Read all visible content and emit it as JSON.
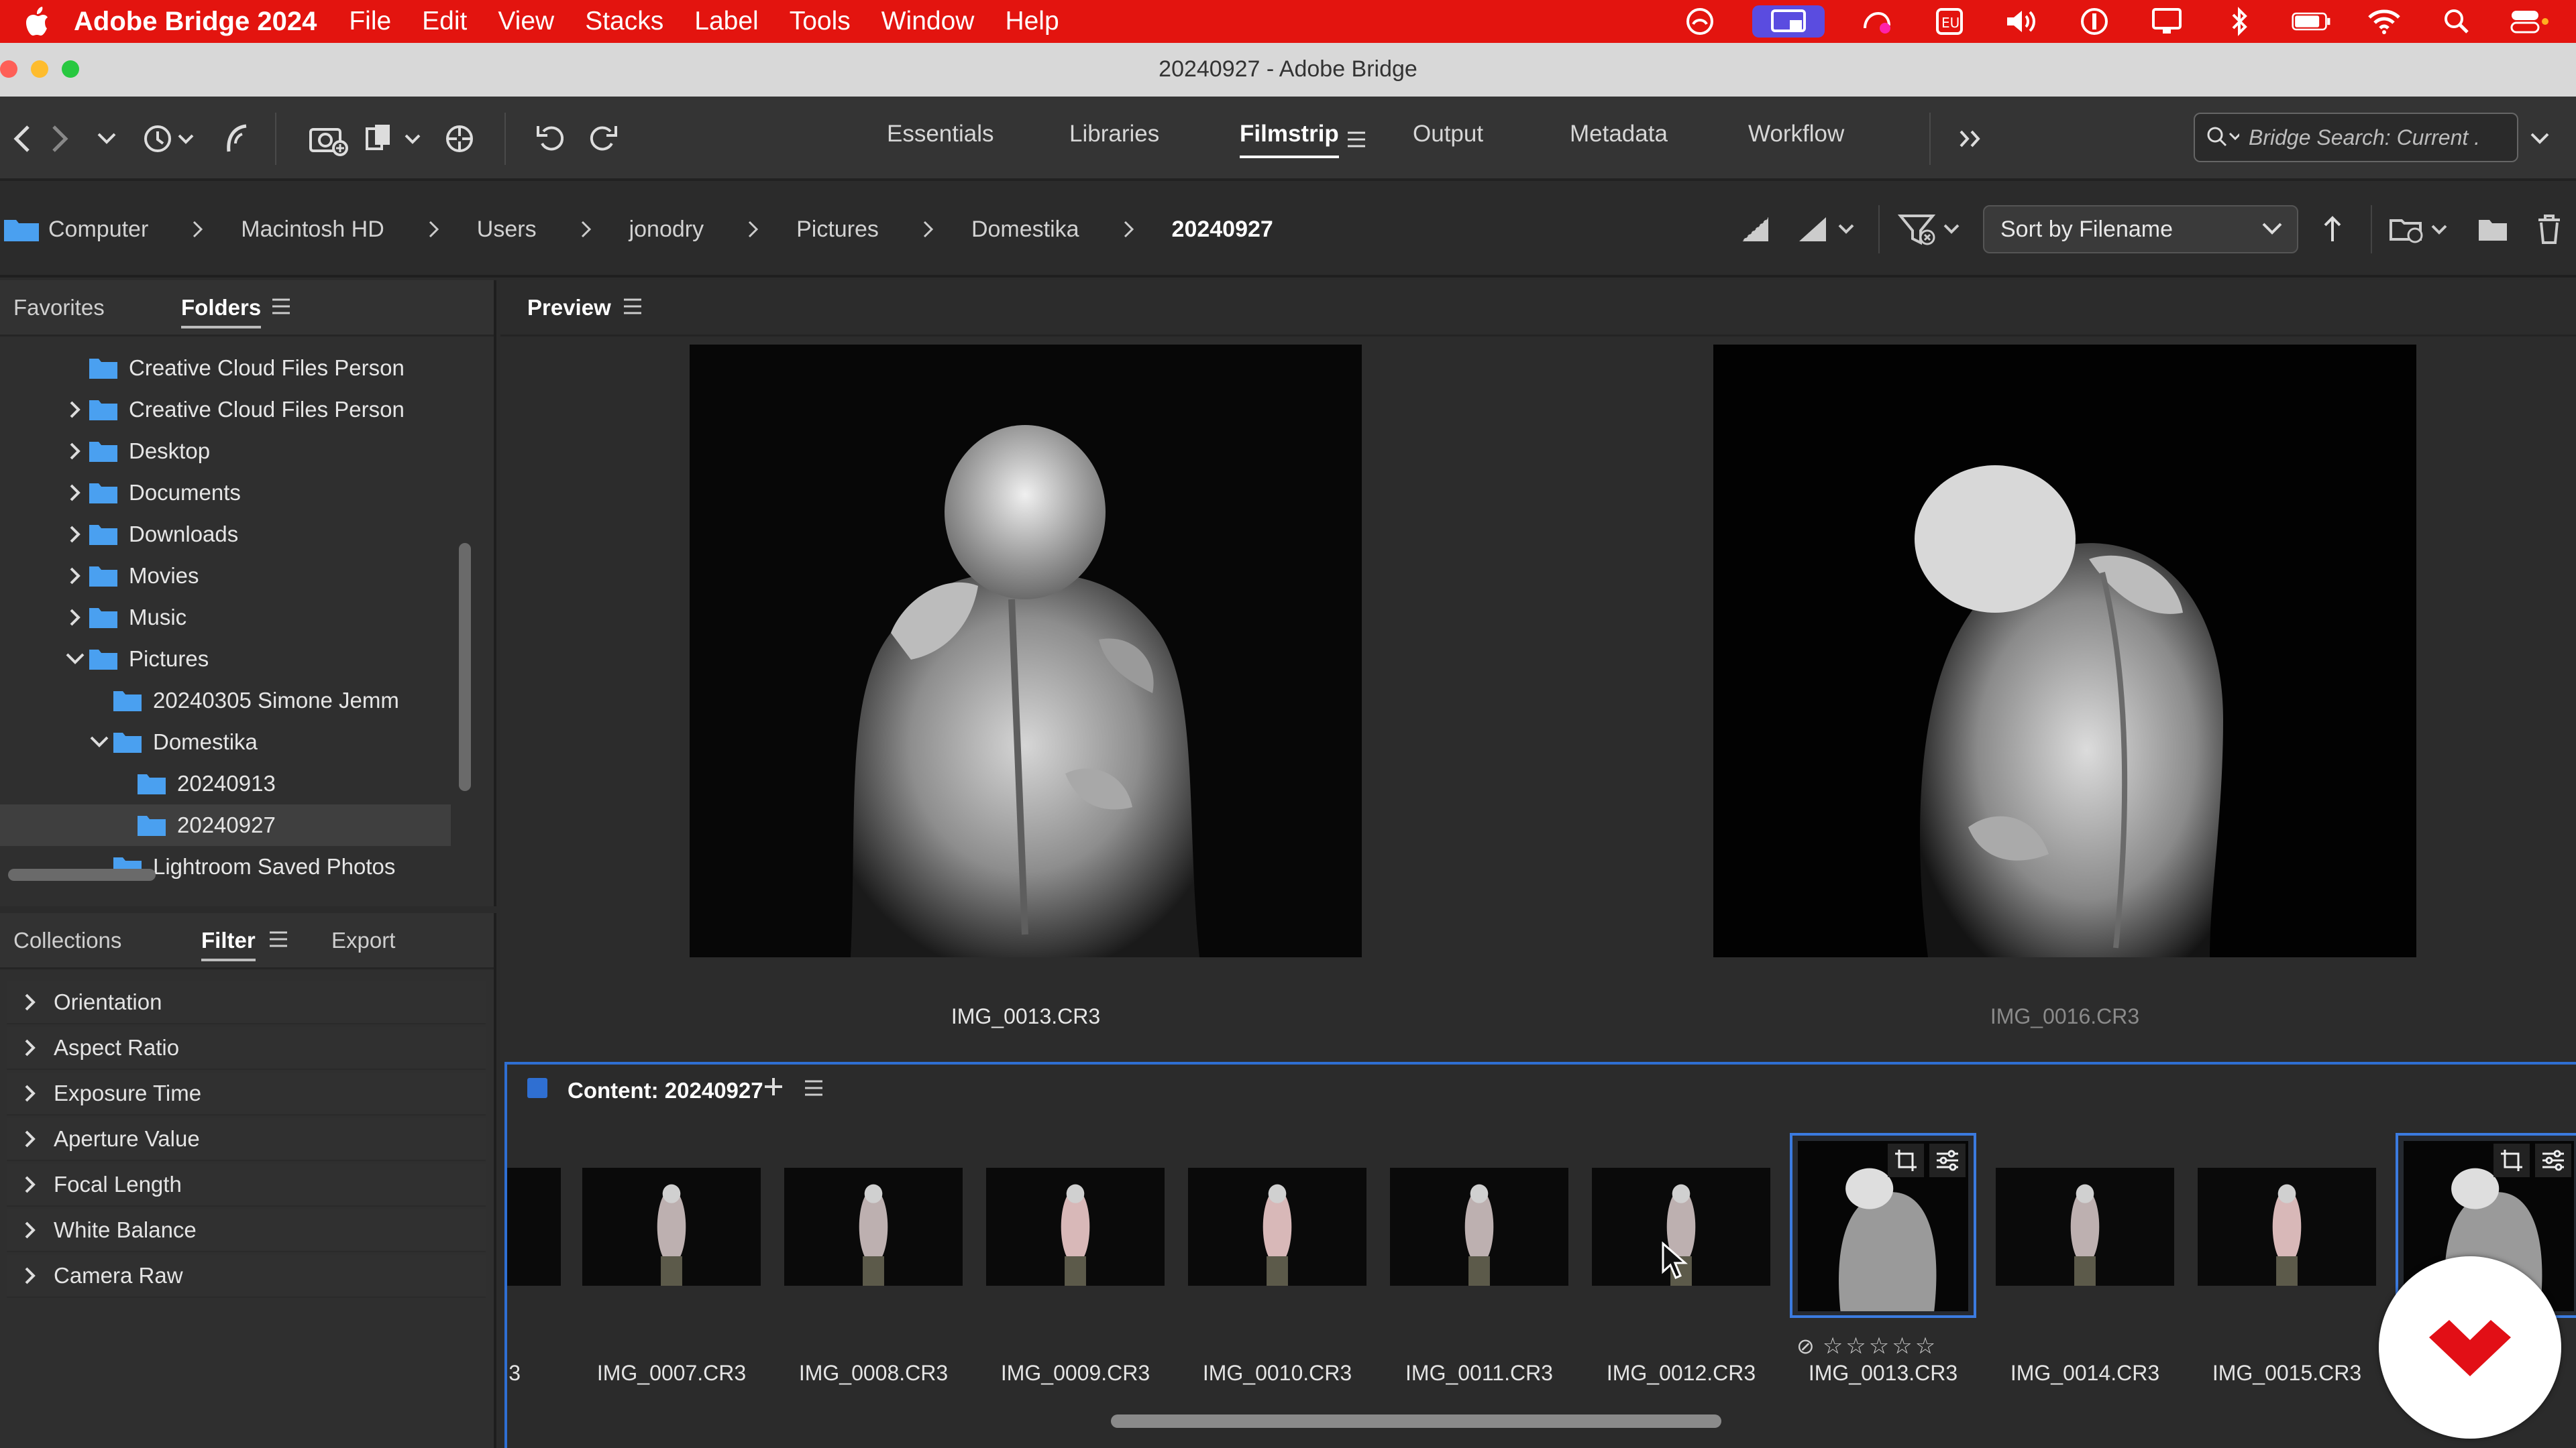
{
  "menubar": {
    "app_name": "Adobe Bridge 2024",
    "menus": [
      "File",
      "Edit",
      "View",
      "Stacks",
      "Label",
      "Tools",
      "Window",
      "Help"
    ],
    "status_icons": [
      "creative-cloud-icon",
      "screen-share-icon",
      "cc-sync-icon",
      "eu-input-icon",
      "volume-icon",
      "one-password-icon",
      "display-icon",
      "bluetooth-icon",
      "battery-icon",
      "wifi-icon",
      "spotlight-icon",
      "control-center-icon"
    ],
    "bar_color": "#e3140f"
  },
  "window": {
    "title": "20240927 - Adobe Bridge"
  },
  "toolbar": {
    "workspaces": [
      "Essentials",
      "Libraries",
      "Filmstrip",
      "Output",
      "Metadata",
      "Workflow"
    ],
    "active_workspace": "Filmstrip",
    "search_placeholder": "Bridge Search: Current ."
  },
  "path": {
    "crumbs": [
      "Computer",
      "Macintosh HD",
      "Users",
      "jonodry",
      "Pictures",
      "Domestika",
      "20240927"
    ],
    "sort_label": "Sort by Filename"
  },
  "left_panel": {
    "tabs": [
      "Favorites",
      "Folders"
    ],
    "active_tab": "Folders",
    "folders": [
      {
        "label": "Creative Cloud Files Person",
        "indent": 0,
        "arrow": "none"
      },
      {
        "label": "Creative Cloud Files Person",
        "indent": 0,
        "arrow": "right"
      },
      {
        "label": "Desktop",
        "indent": 0,
        "arrow": "right"
      },
      {
        "label": "Documents",
        "indent": 0,
        "arrow": "right"
      },
      {
        "label": "Downloads",
        "indent": 0,
        "arrow": "right"
      },
      {
        "label": "Movies",
        "indent": 0,
        "arrow": "right"
      },
      {
        "label": "Music",
        "indent": 0,
        "arrow": "right"
      },
      {
        "label": "Pictures",
        "indent": 0,
        "arrow": "down"
      },
      {
        "label": "20240305 Simone Jemm",
        "indent": 1,
        "arrow": "none"
      },
      {
        "label": "Domestika",
        "indent": 1,
        "arrow": "down"
      },
      {
        "label": "20240913",
        "indent": 2,
        "arrow": "none"
      },
      {
        "label": "20240927",
        "indent": 2,
        "arrow": "none",
        "selected": true
      },
      {
        "label": "Lightroom Saved Photos",
        "indent": 1,
        "arrow": "none"
      }
    ]
  },
  "filter_panel": {
    "tabs": [
      "Collections",
      "Filter",
      "Export"
    ],
    "active_tab": "Filter",
    "items": [
      "Orientation",
      "Aspect Ratio",
      "Exposure Time",
      "Aperture Value",
      "Focal Length",
      "White Balance",
      "Camera Raw"
    ]
  },
  "preview": {
    "title": "Preview",
    "images": [
      {
        "caption": "IMG_0013.CR3"
      },
      {
        "caption": "IMG_0016.CR3"
      }
    ]
  },
  "content": {
    "title": "Content: 20240927",
    "partial_left_caption": "3",
    "thumbnails": [
      {
        "caption": "IMG_0007.CR3"
      },
      {
        "caption": "IMG_0008.CR3"
      },
      {
        "caption": "IMG_0009.CR3"
      },
      {
        "caption": "IMG_0010.CR3"
      },
      {
        "caption": "IMG_0011.CR3"
      },
      {
        "caption": "IMG_0012.CR3"
      },
      {
        "caption": "IMG_0013.CR3",
        "selected": true
      },
      {
        "caption": "IMG_0014.CR3"
      },
      {
        "caption": "IMG_0015.CR3"
      },
      {
        "caption": ".CR3",
        "selected": true
      }
    ],
    "rating_stars": "☆☆☆☆☆",
    "accent_color": "#2f6fd2"
  },
  "logo": "domestika-logo-icon"
}
